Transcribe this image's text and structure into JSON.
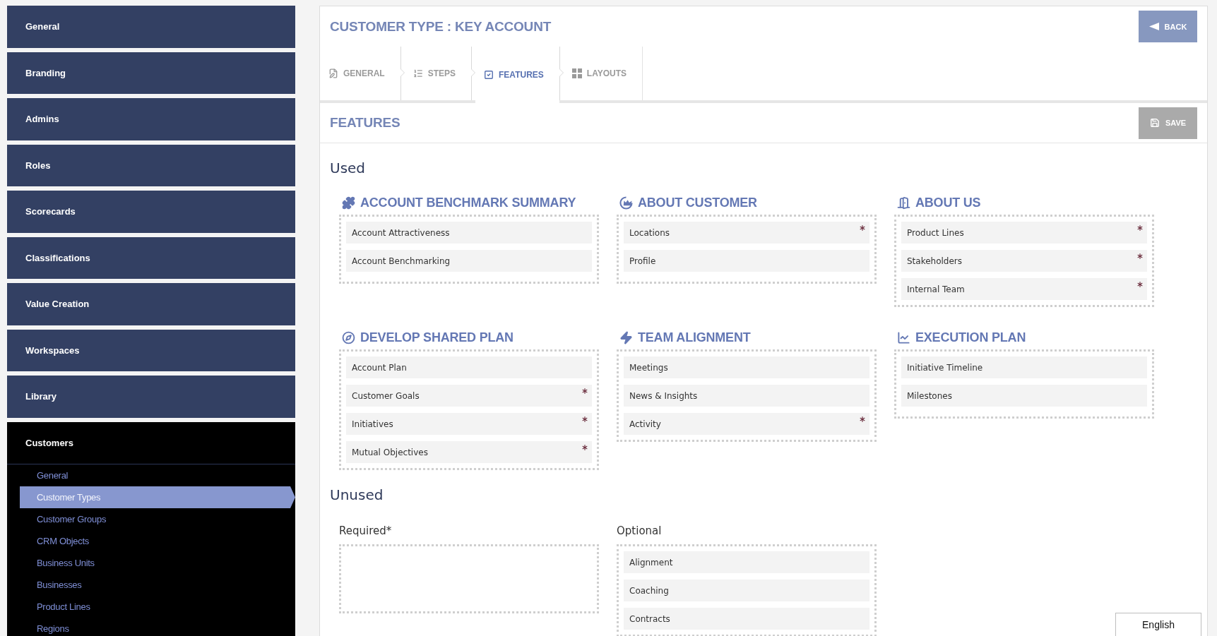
{
  "sidebar": {
    "items": [
      {
        "label": "General",
        "expanded": false
      },
      {
        "label": "Branding",
        "expanded": false
      },
      {
        "label": "Admins",
        "expanded": false
      },
      {
        "label": "Roles",
        "expanded": false
      },
      {
        "label": "Scorecards",
        "expanded": false
      },
      {
        "label": "Classifications",
        "expanded": false
      },
      {
        "label": "Value Creation",
        "expanded": false
      },
      {
        "label": "Workspaces",
        "expanded": false
      },
      {
        "label": "Library",
        "expanded": false
      },
      {
        "label": "Customers",
        "expanded": true,
        "children": [
          {
            "label": "General",
            "selected": false
          },
          {
            "label": "Customer Types",
            "selected": true
          },
          {
            "label": "Customer Groups",
            "selected": false
          },
          {
            "label": "CRM Objects",
            "selected": false
          },
          {
            "label": "Business Units",
            "selected": false
          },
          {
            "label": "Businesses",
            "selected": false
          },
          {
            "label": "Product Lines",
            "selected": false
          },
          {
            "label": "Regions",
            "selected": false
          }
        ]
      }
    ]
  },
  "header": {
    "title": "CUSTOMER TYPE : KEY ACCOUNT",
    "back_button": "BACK"
  },
  "tabs": [
    {
      "label": "GENERAL",
      "selected": false
    },
    {
      "label": "STEPS",
      "selected": false
    },
    {
      "label": "FEATURES",
      "selected": true
    },
    {
      "label": "LAYOUTS",
      "selected": false
    }
  ],
  "section": {
    "title": "FEATURES",
    "save_button": {
      "label": "SAVE",
      "disabled": true
    }
  },
  "used": {
    "heading": "Used",
    "groups": [
      {
        "title": "ACCOUNT BENCHMARK SUMMARY",
        "items": [
          {
            "label": "Account Attractiveness",
            "required": false
          },
          {
            "label": "Account Benchmarking",
            "required": false
          }
        ]
      },
      {
        "title": "ABOUT CUSTOMER",
        "items": [
          {
            "label": "Locations",
            "required": true
          },
          {
            "label": "Profile",
            "required": false
          }
        ]
      },
      {
        "title": "ABOUT US",
        "items": [
          {
            "label": "Product Lines",
            "required": true
          },
          {
            "label": "Stakeholders",
            "required": true
          },
          {
            "label": "Internal Team",
            "required": true
          }
        ]
      },
      {
        "title": "DEVELOP SHARED PLAN",
        "items": [
          {
            "label": "Account Plan",
            "required": false
          },
          {
            "label": "Customer Goals",
            "required": true
          },
          {
            "label": "Initiatives",
            "required": true
          },
          {
            "label": "Mutual Objectives",
            "required": true
          }
        ]
      },
      {
        "title": "TEAM ALIGNMENT",
        "items": [
          {
            "label": "Meetings",
            "required": false
          },
          {
            "label": "News & Insights",
            "required": false
          },
          {
            "label": "Activity",
            "required": true
          }
        ]
      },
      {
        "title": "EXECUTION PLAN",
        "items": [
          {
            "label": "Initiative Timeline",
            "required": false
          },
          {
            "label": "Milestones",
            "required": false
          }
        ]
      }
    ]
  },
  "unused": {
    "heading": "Unused",
    "required": {
      "label": "Required*"
    },
    "optional": {
      "label": "Optional",
      "items": [
        {
          "label": "Alignment",
          "required": false
        },
        {
          "label": "Coaching",
          "required": false
        },
        {
          "label": "Contracts",
          "required": false
        }
      ]
    }
  },
  "language_button": "English"
}
